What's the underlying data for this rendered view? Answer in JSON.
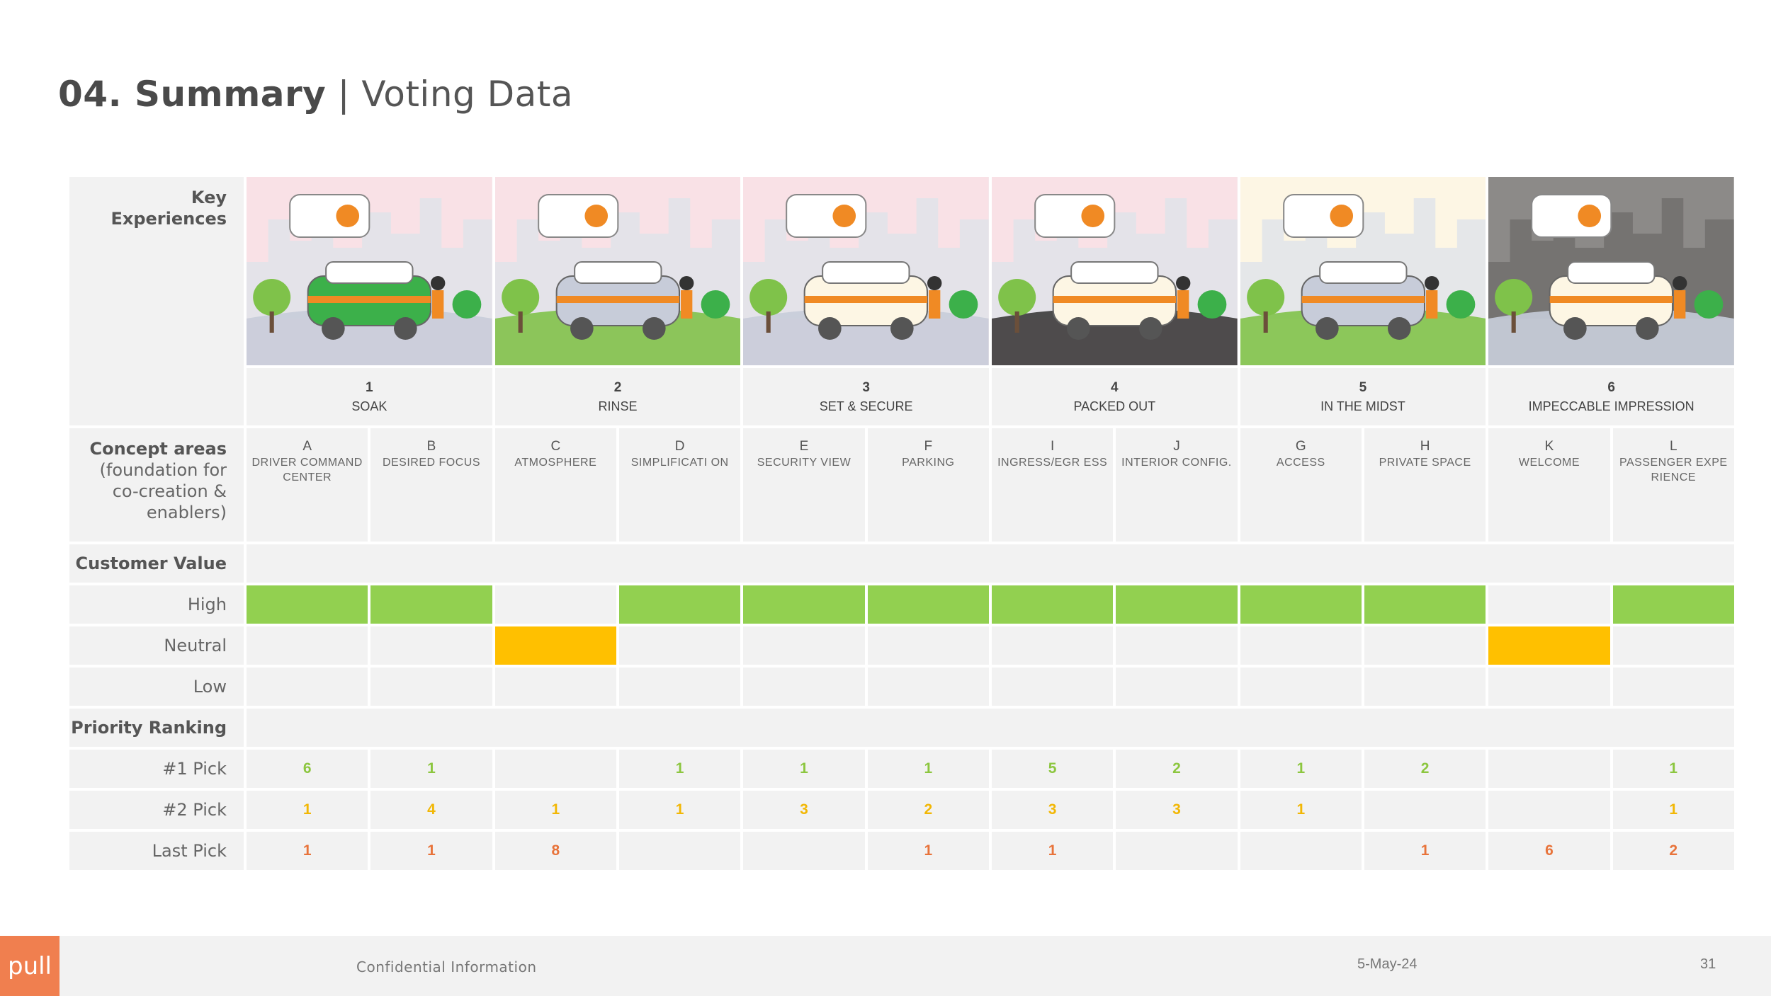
{
  "title": {
    "bold": "04. Summary",
    "light": " | Voting Data"
  },
  "row_labels": {
    "key_experiences": [
      "Key",
      "Experiences"
    ],
    "concept_areas": [
      "Concept areas",
      "(foundation for",
      "co-creation &",
      "enablers)"
    ],
    "customer_value": "Customer Value",
    "high": "High",
    "neutral": "Neutral",
    "low": "Low",
    "priority_ranking": "Priority Ranking",
    "pick1": "#1 Pick",
    "pick2": "#2 Pick",
    "last": "Last Pick"
  },
  "experiences": [
    {
      "num": "1",
      "name": "SOAK",
      "illustration": "driver-command-scene"
    },
    {
      "num": "2",
      "name": "RINSE",
      "illustration": "city-van-scene"
    },
    {
      "num": "3",
      "name": "SET & SECURE",
      "illustration": "parking-scene"
    },
    {
      "num": "4",
      "name": "PACKED OUT",
      "illustration": "loading-scene"
    },
    {
      "num": "5",
      "name": "IN THE MIDST",
      "illustration": "park-fountain-scene"
    },
    {
      "num": "6",
      "name": "IMPECCABLE IMPRESSION",
      "illustration": "welcome-cabin-scene"
    }
  ],
  "concepts": [
    {
      "letter": "A",
      "name": "DRIVER COMMAND CENTER"
    },
    {
      "letter": "B",
      "name": "DESIRED FOCUS"
    },
    {
      "letter": "C",
      "name": "ATMOSPHERE"
    },
    {
      "letter": "D",
      "name": "SIMPLIFICATI ON"
    },
    {
      "letter": "E",
      "name": "SECURITY VIEW"
    },
    {
      "letter": "F",
      "name": "PARKING"
    },
    {
      "letter": "I",
      "name": "INGRESS/EGR ESS"
    },
    {
      "letter": "J",
      "name": "INTERIOR CONFIG."
    },
    {
      "letter": "G",
      "name": "ACCESS"
    },
    {
      "letter": "H",
      "name": "PRIVATE SPACE"
    },
    {
      "letter": "K",
      "name": "WELCOME"
    },
    {
      "letter": "L",
      "name": "PASSENGER EXPERIENCE"
    }
  ],
  "customer_value": [
    "high",
    "high",
    "neutral",
    "high",
    "high",
    "high",
    "high",
    "high",
    "high",
    "high",
    "neutral",
    "high"
  ],
  "colors": {
    "high": "#92d050",
    "neutral": "#ffc000",
    "pick1": "#8cc63f",
    "pick2": "#f2b705",
    "last": "#e8733a",
    "brand": "#f07f4f"
  },
  "picks": {
    "first": [
      "6",
      "1",
      "",
      "1",
      "1",
      "1",
      "5",
      "2",
      "1",
      "2",
      "",
      "1"
    ],
    "second": [
      "1",
      "4",
      "1",
      "1",
      "3",
      "2",
      "3",
      "3",
      "1",
      "",
      "",
      "1"
    ],
    "last": [
      "1",
      "1",
      "8",
      "",
      "",
      "1",
      "1",
      "",
      "",
      "1",
      "6",
      "2"
    ]
  },
  "footer": {
    "logo": "pull",
    "confidential": "Confidential Information",
    "date": "5-May-24",
    "page": "31"
  }
}
